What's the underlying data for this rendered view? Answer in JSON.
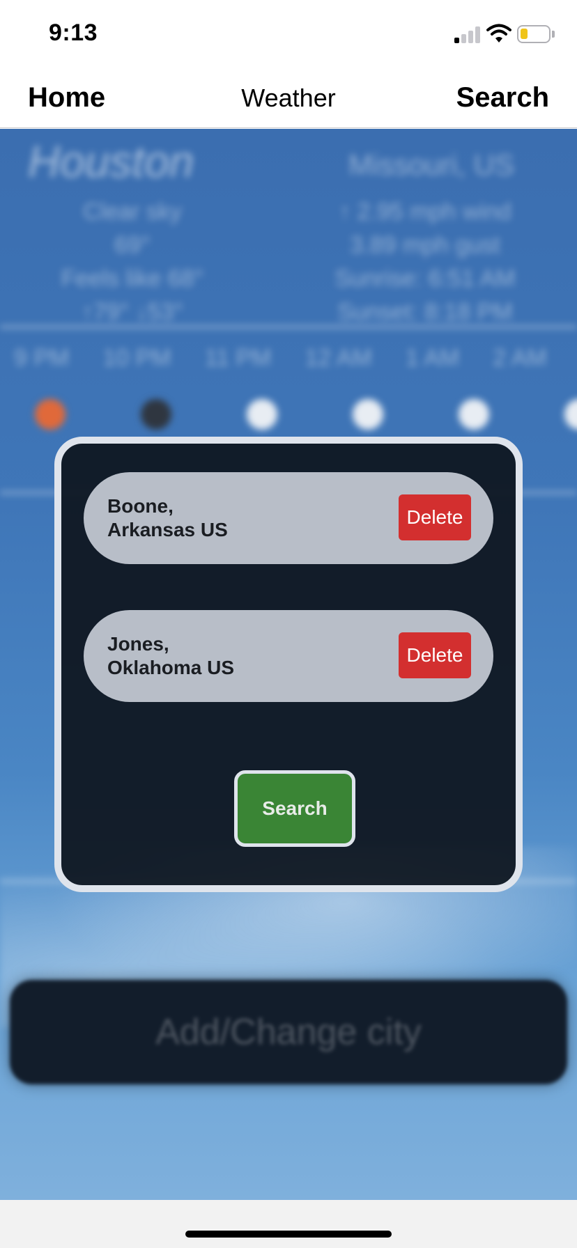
{
  "status_bar": {
    "time": "9:13",
    "battery_color": "#f0c419"
  },
  "nav": {
    "left": "Home",
    "title": "Weather",
    "right": "Search"
  },
  "background": {
    "city": "Houston",
    "region": "Missouri, US",
    "left_lines": [
      "Clear sky",
      "69°",
      "Feels like 68°",
      "↑79° ↓53°"
    ],
    "right_lines": [
      "↑ 2.95 mph wind",
      "3.89 mph gust",
      "Sunrise: 6:51 AM",
      "Sunset: 8:18 PM"
    ],
    "hours": [
      "9 PM",
      "10 PM",
      "11 PM",
      "12 AM",
      "1 AM",
      "2 AM"
    ],
    "add_button": "Add/Change city"
  },
  "modal": {
    "cities": [
      {
        "line1": "Boone,",
        "line2": "Arkansas US",
        "delete_label": "Delete"
      },
      {
        "line1": "Jones,",
        "line2": "Oklahoma US",
        "delete_label": "Delete"
      }
    ],
    "search_label": "Search",
    "colors": {
      "delete": "#d32f2f",
      "search": "#3a8535"
    }
  }
}
